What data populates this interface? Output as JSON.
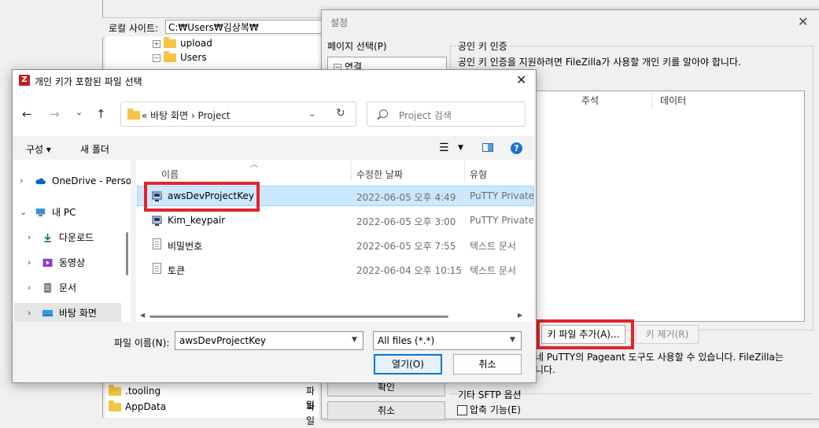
{
  "background": {
    "local_site_label": "로컬 사이트:",
    "local_site_path": "C:₩Users₩김상복₩",
    "tree": [
      {
        "label": "upload",
        "expander": "+"
      },
      {
        "label": "Users",
        "expander": "−"
      }
    ],
    "bottom_list": [
      {
        "name": ".tooling",
        "type": "파일"
      },
      {
        "name": "AppData",
        "type": "파일"
      }
    ]
  },
  "settings": {
    "title": "설정",
    "page_select_label": "페이지 선택(P)",
    "tree_item": "연결",
    "pubkey_group_title": "공인 키 인증",
    "pubkey_desc": "공인 키 인증을 지원하려면 FileZilla가 사용할 개인 키를 알아야 합니다.",
    "list_columns": [
      "주석",
      "데이터"
    ],
    "add_key_button": "키 파일 추가(A)...",
    "remove_key_button": "키 제거(R)",
    "pageant_note_line1": "네 PuTTY의 Pageant 도구도 사용할 수 있습니다. FileZilla는",
    "pageant_note_line2": "니다.",
    "confirm_button": "확인",
    "cancel_button": "취소",
    "sftp_group_label": "기타 SFTP 옵션",
    "compress_label": "압축 기능(E)"
  },
  "file_dialog": {
    "title": "개인 키가 포함된 파일 선택",
    "app_icon_letter": "Z",
    "breadcrumb": "«  바탕 화면  ›  Project",
    "search_placeholder": "Project 검색",
    "organize": "구성 ▾",
    "new_folder": "새 폴더",
    "nav_items": [
      {
        "label": "OneDrive - Personal",
        "chevron": "›"
      },
      {
        "label": "내 PC",
        "chevron": "⌄"
      },
      {
        "label": "다운로드",
        "chevron": "›"
      },
      {
        "label": "동영상",
        "chevron": "›"
      },
      {
        "label": "문서",
        "chevron": "›"
      },
      {
        "label": "바탕 화면",
        "chevron": "›"
      }
    ],
    "columns": {
      "name": "이름",
      "date": "수정한 날짜",
      "type": "유형"
    },
    "files": [
      {
        "name": "awsDevProjectKey",
        "date": "2022-06-05 오후 4:49",
        "type": "PuTTY Private Key File",
        "icon": "putty-key-icon",
        "selected": true
      },
      {
        "name": "Kim_keypair",
        "date": "2022-06-05 오후 3:00",
        "type": "PuTTY Private Key File",
        "icon": "putty-key-icon",
        "selected": false
      },
      {
        "name": "비밀번호",
        "date": "2022-06-05 오후 7:55",
        "type": "텍스트 문서",
        "icon": "text-file-icon",
        "selected": false
      },
      {
        "name": "토큰",
        "date": "2022-06-04 오후 10:15",
        "type": "텍스트 문서",
        "icon": "text-file-icon",
        "selected": false
      }
    ],
    "file_name_label": "파일 이름(N):",
    "file_name_value": "awsDevProjectKey",
    "file_type_value": "All files (*.*)",
    "open_button": "열기(O)",
    "cancel_button": "취소"
  },
  "colors": {
    "highlight": "#e3242b",
    "selection": "#cce8ff",
    "accent": "#0078d7"
  }
}
